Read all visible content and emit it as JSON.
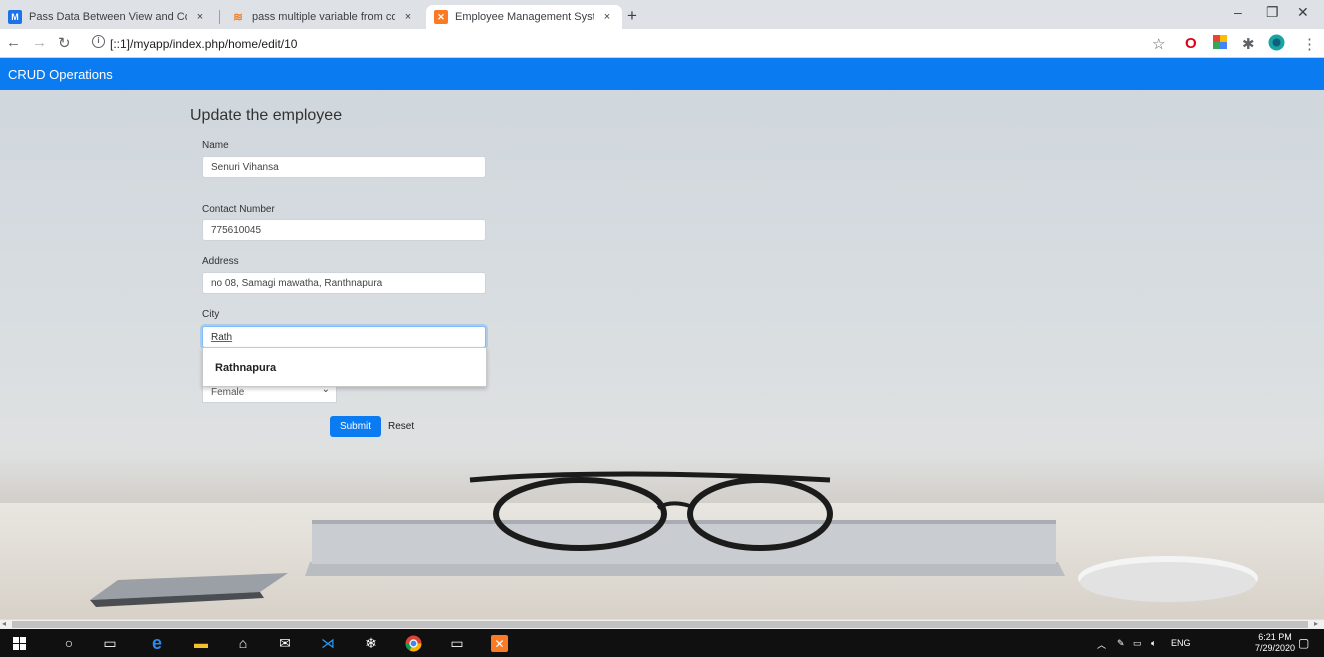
{
  "browser": {
    "tabs": [
      {
        "title": "Pass Data Between View and Cor",
        "favicon": "m-logo-icon",
        "color": "#1a73e8",
        "active": false
      },
      {
        "title": "pass multiple variable from contr",
        "favicon": "stackoverflow-icon",
        "color": "#f48024",
        "active": false
      },
      {
        "title": "Employee Management System",
        "favicon": "xampp-icon",
        "color": "#fb7a24",
        "active": true
      }
    ],
    "tab_close": "×",
    "new_tab": "+",
    "window_controls": {
      "minimize": "–",
      "maximize": "❐",
      "close": "✕"
    },
    "url": "[::1]/myapp/index.php/home/edit/10"
  },
  "navbar": {
    "brand": "CRUD Operations",
    "color": "#0b7bf2"
  },
  "form": {
    "title": "Update the employee",
    "name": {
      "label": "Name",
      "value": "Senuri Vihansa"
    },
    "contact": {
      "label": "Contact Number",
      "value": "775610045"
    },
    "address": {
      "label": "Address",
      "value": "no 08, Samagi mawatha, Ranthnapura"
    },
    "city": {
      "label": "City",
      "value": "Rath"
    },
    "autocomplete": [
      "Rathnapura"
    ],
    "gender": {
      "value": "Female"
    },
    "submit": "Submit",
    "reset": "Reset"
  },
  "taskbar": {
    "language": "ENG",
    "time": "6:21 PM",
    "date": "7/29/2020"
  }
}
